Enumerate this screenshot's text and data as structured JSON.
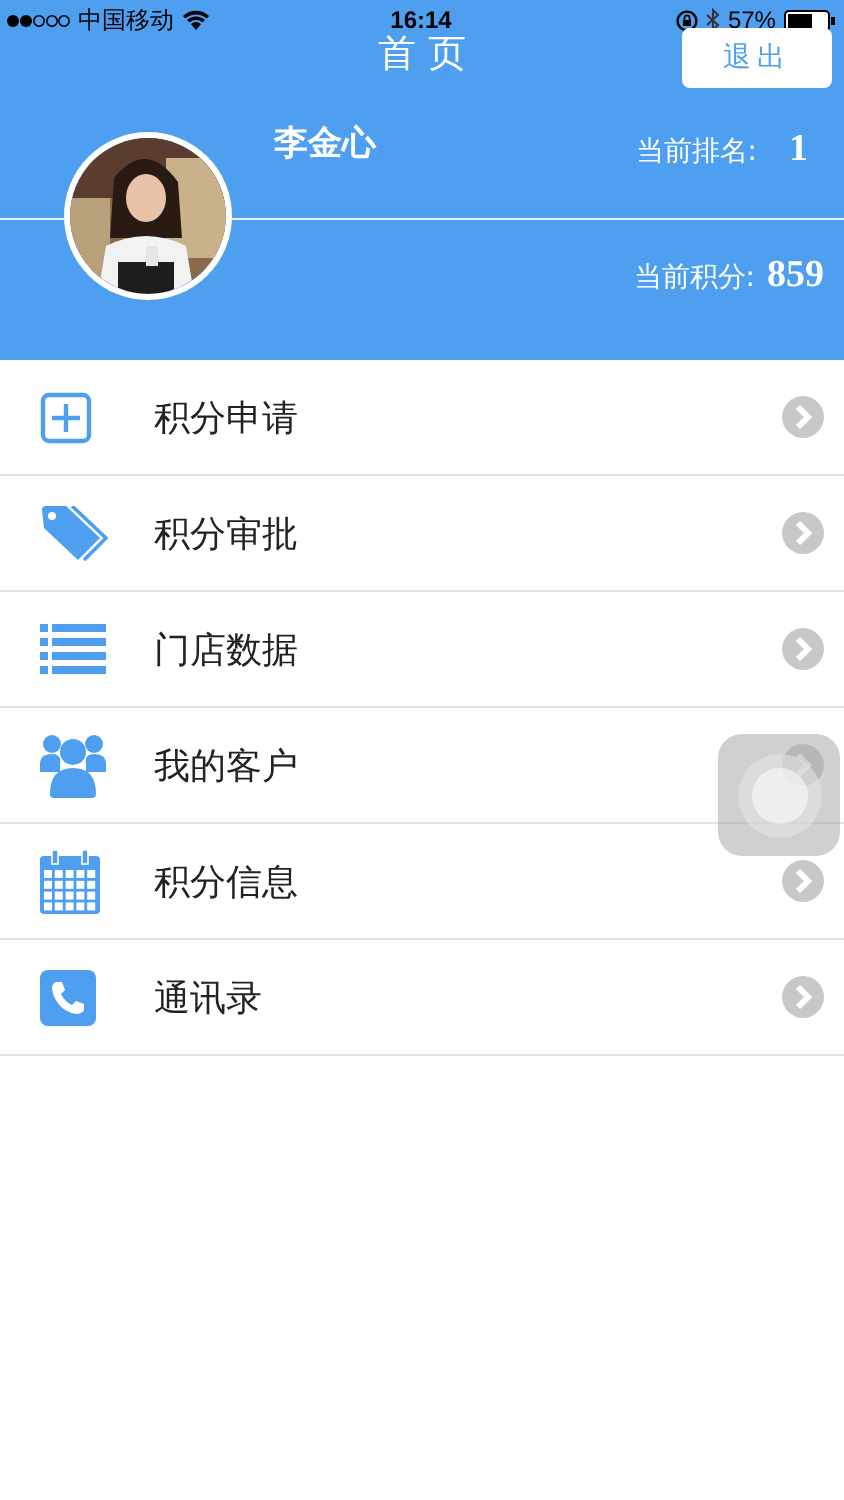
{
  "status_bar": {
    "carrier": "中国移动",
    "time": "16:14",
    "battery": "57%"
  },
  "nav": {
    "title": "首 页",
    "logout": "退出"
  },
  "profile": {
    "name": "李金心",
    "rank_label": "当前排名:",
    "rank": "1",
    "points_label": "当前积分:",
    "points": "859"
  },
  "menu": [
    {
      "label": "积分申请"
    },
    {
      "label": "积分审批"
    },
    {
      "label": "门店数据"
    },
    {
      "label": "我的客户"
    },
    {
      "label": "积分信息"
    },
    {
      "label": "通讯录"
    }
  ]
}
